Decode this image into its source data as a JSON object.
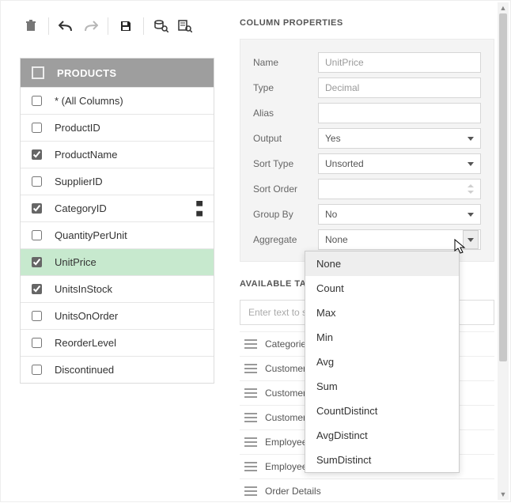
{
  "toolbar": {
    "delete": "delete",
    "undo": "undo",
    "redo": "redo",
    "save": "save",
    "query": "query",
    "preview": "preview"
  },
  "table": {
    "title": "PRODUCTS",
    "rows": [
      {
        "label": "* (All Columns)",
        "checked": false
      },
      {
        "label": "ProductID",
        "checked": false
      },
      {
        "label": "ProductName",
        "checked": true
      },
      {
        "label": "SupplierID",
        "checked": false
      },
      {
        "label": "CategoryID",
        "checked": true,
        "sort": true
      },
      {
        "label": "QuantityPerUnit",
        "checked": false
      },
      {
        "label": "UnitPrice",
        "checked": true,
        "selected": true
      },
      {
        "label": "UnitsInStock",
        "checked": true
      },
      {
        "label": "UnitsOnOrder",
        "checked": false
      },
      {
        "label": "ReorderLevel",
        "checked": false
      },
      {
        "label": "Discontinued",
        "checked": false
      }
    ]
  },
  "column_props": {
    "title": "COLUMN PROPERTIES",
    "labels": {
      "name": "Name",
      "type": "Type",
      "alias": "Alias",
      "output": "Output",
      "sort_type": "Sort Type",
      "sort_order": "Sort Order",
      "group_by": "Group By",
      "aggregate": "Aggregate"
    },
    "values": {
      "name": "UnitPrice",
      "type": "Decimal",
      "alias": "",
      "output": "Yes",
      "sort_type": "Unsorted",
      "sort_order": "",
      "group_by": "No",
      "aggregate": "None"
    }
  },
  "aggregate_options": [
    "None",
    "Count",
    "Max",
    "Min",
    "Avg",
    "Sum",
    "CountDistinct",
    "AvgDistinct",
    "SumDistinct"
  ],
  "available": {
    "title": "AVAILABLE TABLES AND VIEWS",
    "search_placeholder": "Enter text to search...",
    "items": [
      "Categories",
      "CustomerCustomerDemo",
      "CustomerDemographics",
      "Customers",
      "EmployeeTerritories",
      "Employees",
      "Order Details"
    ]
  }
}
